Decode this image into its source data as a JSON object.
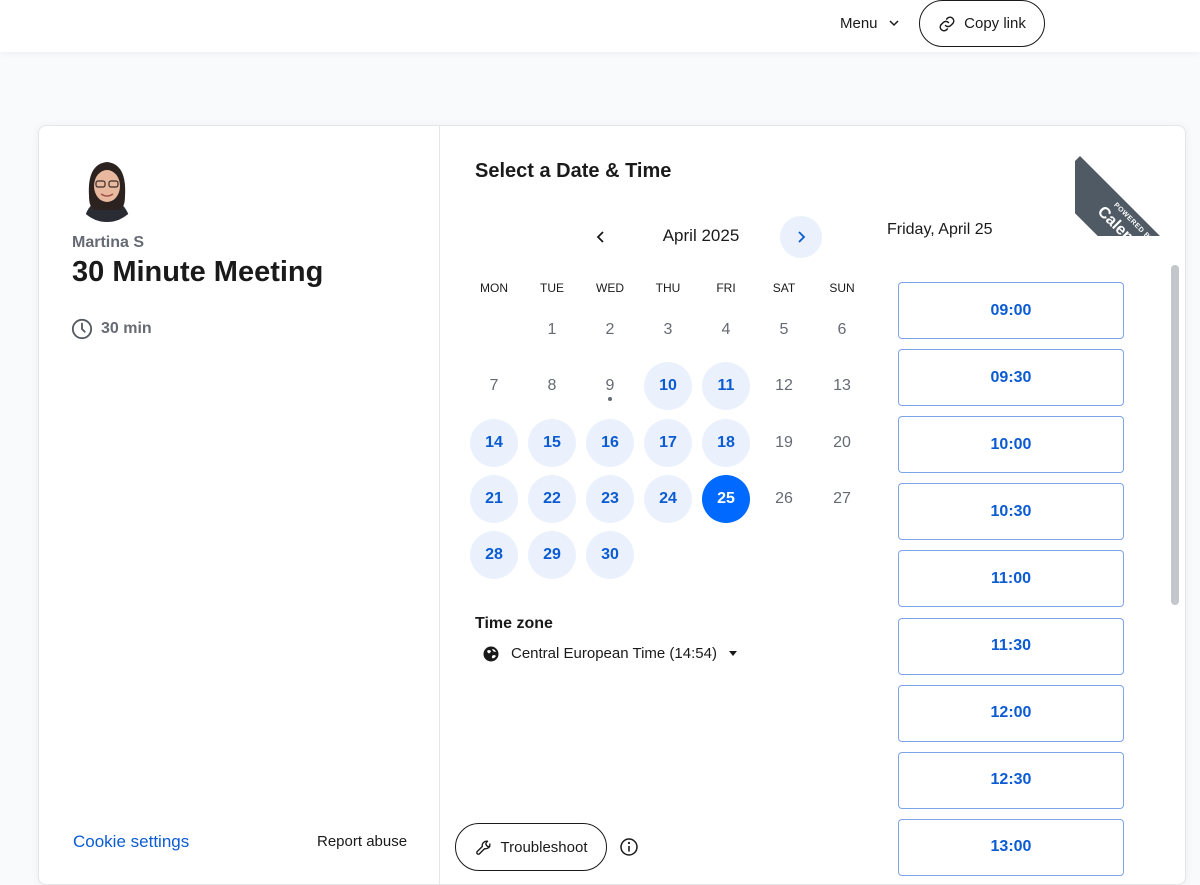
{
  "topbar": {
    "menu_label": "Menu",
    "copy_link_label": "Copy link"
  },
  "host": {
    "name": "Martina S",
    "event_title": "30 Minute Meeting",
    "duration": "30 min"
  },
  "footer": {
    "cookie_settings": "Cookie settings",
    "report_abuse": "Report abuse",
    "troubleshoot": "Troubleshoot"
  },
  "branding": {
    "powered_by": "POWERED BY",
    "brand": "Calendly"
  },
  "scheduler": {
    "title": "Select a Date & Time",
    "month": "April 2025",
    "weekdays": [
      "MON",
      "TUE",
      "WED",
      "THU",
      "FRI",
      "SAT",
      "SUN"
    ],
    "days": [
      {
        "label": "1",
        "state": "plain"
      },
      {
        "label": "2",
        "state": "plain"
      },
      {
        "label": "3",
        "state": "plain"
      },
      {
        "label": "4",
        "state": "plain"
      },
      {
        "label": "5",
        "state": "plain"
      },
      {
        "label": "6",
        "state": "plain"
      },
      {
        "label": "7",
        "state": "plain"
      },
      {
        "label": "8",
        "state": "plain"
      },
      {
        "label": "9",
        "state": "today"
      },
      {
        "label": "10",
        "state": "available"
      },
      {
        "label": "11",
        "state": "available"
      },
      {
        "label": "12",
        "state": "plain"
      },
      {
        "label": "13",
        "state": "plain"
      },
      {
        "label": "14",
        "state": "available"
      },
      {
        "label": "15",
        "state": "available"
      },
      {
        "label": "16",
        "state": "available"
      },
      {
        "label": "17",
        "state": "available"
      },
      {
        "label": "18",
        "state": "available"
      },
      {
        "label": "19",
        "state": "plain"
      },
      {
        "label": "20",
        "state": "plain"
      },
      {
        "label": "21",
        "state": "available"
      },
      {
        "label": "22",
        "state": "available"
      },
      {
        "label": "23",
        "state": "available"
      },
      {
        "label": "24",
        "state": "available"
      },
      {
        "label": "25",
        "state": "selected"
      },
      {
        "label": "26",
        "state": "plain"
      },
      {
        "label": "27",
        "state": "plain"
      },
      {
        "label": "28",
        "state": "available"
      },
      {
        "label": "29",
        "state": "available"
      },
      {
        "label": "30",
        "state": "available"
      }
    ],
    "timezone_label": "Time zone",
    "timezone_value": "Central European Time (14:54)",
    "selected_date": "Friday, April 25",
    "slots": [
      "09:00",
      "09:30",
      "10:00",
      "10:30",
      "11:00",
      "11:30",
      "12:00",
      "12:30",
      "13:00"
    ]
  },
  "colors": {
    "accent": "#0069ff",
    "link": "#0b5bd3",
    "available_bg": "#eaf1fc",
    "ribbon": "#4f5a65"
  }
}
